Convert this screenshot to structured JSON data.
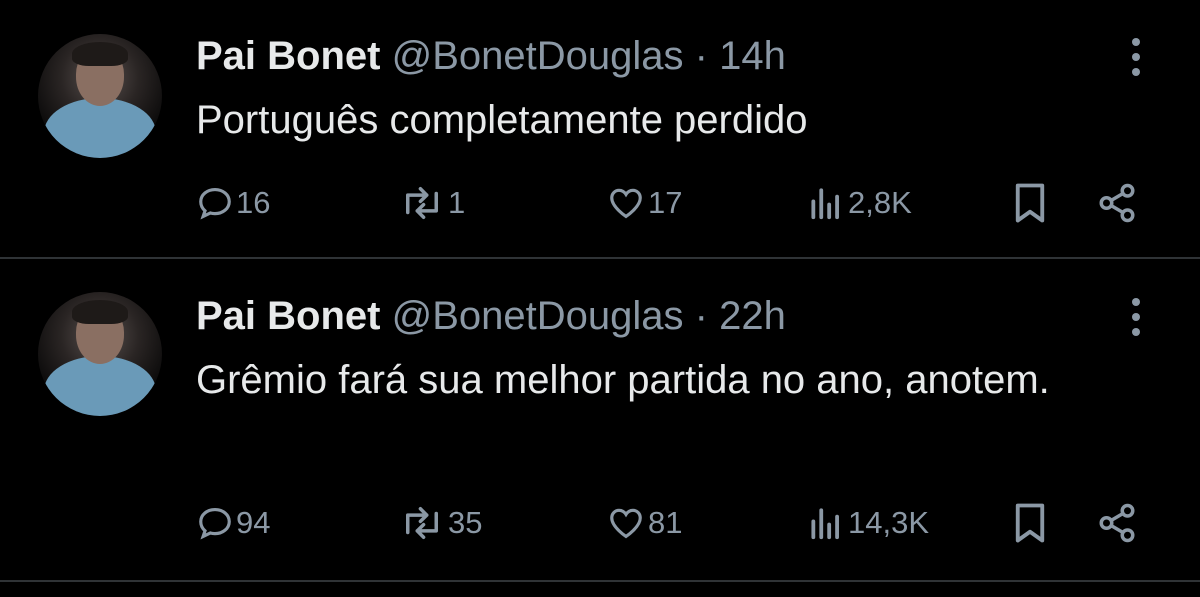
{
  "tweets": [
    {
      "author_name": "Pai Bonet",
      "handle": "@BonetDouglas",
      "separator": "·",
      "time": "14h",
      "text": "Português completamente perdido",
      "replies": "16",
      "retweets": "1",
      "likes": "17",
      "views": "2,8K"
    },
    {
      "author_name": "Pai Bonet",
      "handle": "@BonetDouglas",
      "separator": "·",
      "time": "22h",
      "text": "Grêmio fará sua melhor partida  no ano, anotem.",
      "replies": "94",
      "retweets": "35",
      "likes": "81",
      "views": "14,3K"
    }
  ],
  "icons": {
    "more": "more-vertical-icon",
    "reply": "reply-bubble-icon",
    "retweet": "retweet-icon",
    "like": "heart-icon",
    "views": "analytics-bars-icon",
    "bookmark": "bookmark-icon",
    "share": "share-icon"
  },
  "colors": {
    "background": "#000000",
    "primary_text": "#e7e9ea",
    "secondary_text": "#8b98a5",
    "divider": "#2f3336"
  }
}
